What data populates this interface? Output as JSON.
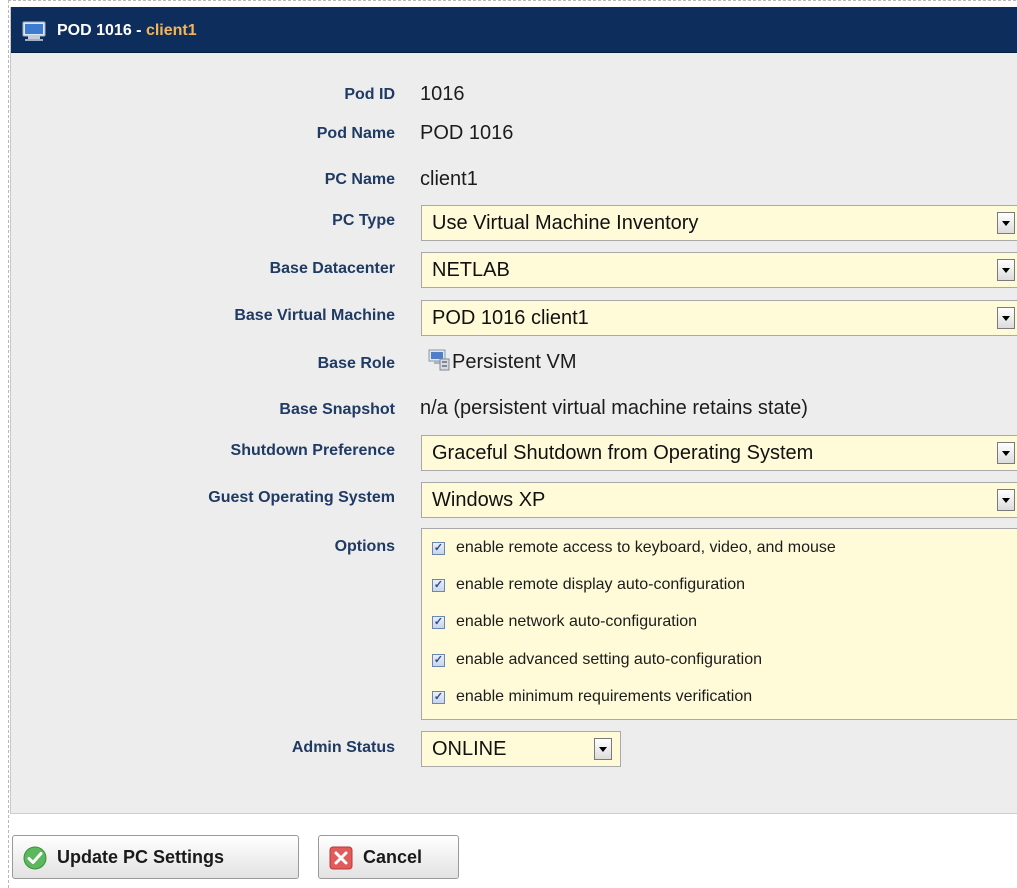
{
  "window": {
    "title_pod": "POD 1016",
    "title_separator": "-",
    "title_pc": "client1",
    "icon": "monitor-icon"
  },
  "fields": {
    "pod_id": {
      "label": "Pod ID",
      "value": "1016"
    },
    "pod_name": {
      "label": "Pod Name",
      "value": "POD 1016"
    },
    "pc_name": {
      "label": "PC Name",
      "value": "client1"
    },
    "pc_type": {
      "label": "PC Type",
      "value": "Use Virtual Machine Inventory"
    },
    "base_datacenter": {
      "label": "Base Datacenter",
      "value": "NETLAB"
    },
    "base_vm": {
      "label": "Base Virtual Machine",
      "value": "POD 1016 client1"
    },
    "base_role": {
      "label": "Base Role",
      "value": "Persistent VM",
      "icon": "persistent-vm-icon"
    },
    "base_snapshot": {
      "label": "Base Snapshot",
      "value": "n/a (persistent virtual machine retains state)"
    },
    "shutdown_pref": {
      "label": "Shutdown Preference",
      "value": "Graceful Shutdown from Operating System"
    },
    "guest_os": {
      "label": "Guest Operating System",
      "value": "Windows XP"
    },
    "options": {
      "label": "Options",
      "items": [
        {
          "label": "enable remote access to keyboard, video, and mouse",
          "checked": true
        },
        {
          "label": "enable remote display auto-configuration",
          "checked": true
        },
        {
          "label": "enable network auto-configuration",
          "checked": true
        },
        {
          "label": "enable advanced setting auto-configuration",
          "checked": true
        },
        {
          "label": "enable minimum requirements verification",
          "checked": true
        }
      ]
    },
    "admin_status": {
      "label": "Admin Status",
      "value": "ONLINE"
    }
  },
  "buttons": {
    "update_label": "Update PC Settings",
    "cancel_label": "Cancel"
  },
  "colors": {
    "title_bar": "#0d2e5c",
    "title_accent": "#f5b556",
    "label_text": "#1f3a63",
    "field_background": "#fffbd8",
    "panel_background": "#ededed"
  }
}
